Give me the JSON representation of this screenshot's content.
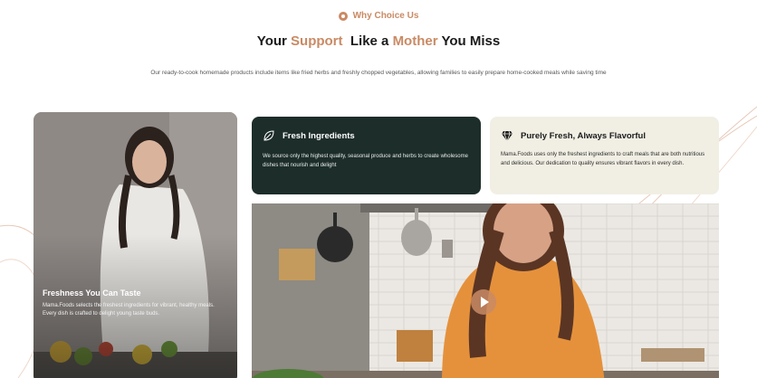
{
  "section": {
    "eyebrow": "Why Choice Us",
    "heading": {
      "part1": "Your ",
      "accent1": "Support",
      "part2": "  Like a ",
      "accent2": "Mother",
      "part3": " You Miss"
    },
    "subtitle": "Our ready-to-cook homemade products include items like fried herbs and freshly chopped vegetables, allowing families to easily prepare home-cooked meals while saving time"
  },
  "feature_left": {
    "title": "Freshness You Can Taste",
    "description": "Mama.Foods selects the freshest ingredients for vibrant, healthy meals. Every dish is crafted to delight young taste buds."
  },
  "card_fresh": {
    "icon": "leaf-icon",
    "title": "Fresh Ingredients",
    "description": "We source only the highest quality, seasonal produce and herbs to create wholesome dishes that nourish and delight"
  },
  "card_flavor": {
    "icon": "diamond-icon",
    "title": "Purely Fresh, Always Flavorful",
    "description": "Mama.Foods uses only the freshest ingredients to craft meals that are both nutritious and delicious. Our dedication to quality ensures vibrant flavors in every dish."
  },
  "video": {
    "icon": "play-icon"
  },
  "colors": {
    "accent": "#c98a64",
    "dark_card": "#1d2d2a",
    "light_card": "#f1efe4"
  }
}
